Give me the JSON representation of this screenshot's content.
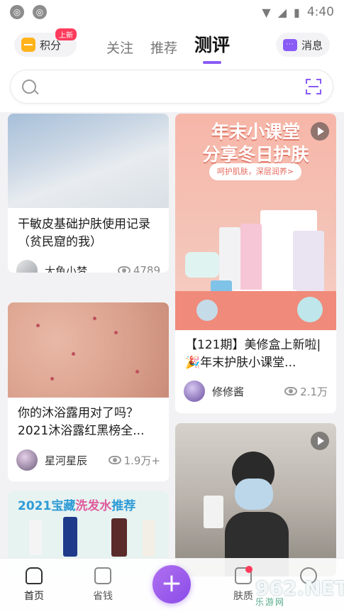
{
  "status_bar": {
    "time": "4:40"
  },
  "header": {
    "points_label": "积分",
    "points_badge": "上新",
    "tabs": [
      {
        "label": "关注"
      },
      {
        "label": "推荐"
      },
      {
        "label": "测评"
      }
    ],
    "active_tab": "测评",
    "messages_label": "消息"
  },
  "search": {
    "placeholder": ""
  },
  "feed": {
    "cards": [
      {
        "title": "干敏皮基础护肤使用记录（贫民窟的我）",
        "author": "大鱼小梦",
        "views": "4789"
      },
      {
        "title": "你的沐浴露用对了吗？2021沐浴露红黑榜全...",
        "author": "星河星辰",
        "views": "1.9万+"
      },
      {
        "title": "【121期】美修盒上新啦|🎉年末护肤小课堂...",
        "author": "修修酱",
        "views": "2.1万",
        "promo_title_1": "年末小课堂",
        "promo_title_2": "分享冬日护肤",
        "promo_tag": "呵护肌肤，深层润养>"
      },
      {
        "banner_title_a": "2021宝藏",
        "banner_title_b": "洗发水",
        "banner_title_c": "推荐"
      }
    ]
  },
  "bottom_nav": {
    "items": [
      {
        "label": "首页"
      },
      {
        "label": "省钱"
      },
      {
        "label": "+"
      },
      {
        "label": "肤质"
      },
      {
        "label": ""
      }
    ]
  },
  "watermark": {
    "big": "962.NET",
    "small": "乐游网"
  },
  "colors": {
    "accent": "#8a5cf6",
    "badge": "#ff3b5c",
    "points": "#ffb31a"
  }
}
